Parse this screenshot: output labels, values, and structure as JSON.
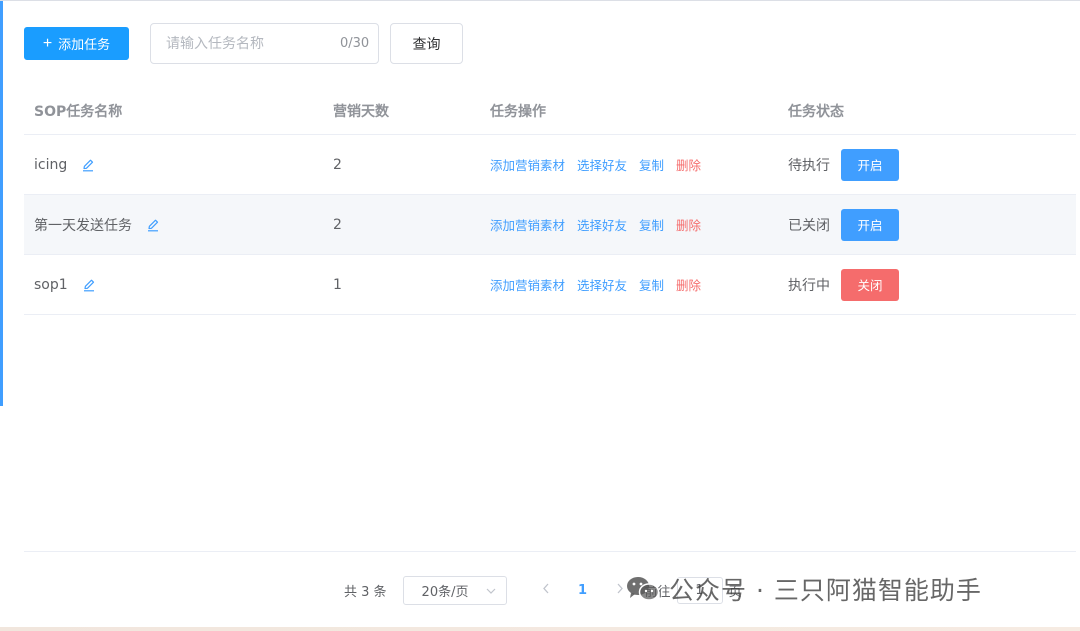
{
  "toolbar": {
    "add_label": "添加任务",
    "search_placeholder": "请输入任务名称",
    "search_value": "",
    "search_count": "0/30",
    "query_label": "查询"
  },
  "table": {
    "headers": [
      "SOP任务名称",
      "营销天数",
      "任务操作",
      "任务状态"
    ],
    "actions": {
      "add_material": "添加营销素材",
      "select_friends": "选择好友",
      "copy": "复制",
      "delete": "删除"
    },
    "rows": [
      {
        "name": "icing",
        "days": "2",
        "status": "待执行",
        "button": "开启",
        "button_color": "#409eff"
      },
      {
        "name": "第一天发送任务",
        "days": "2",
        "status": "已关闭",
        "button": "开启",
        "button_color": "#409eff"
      },
      {
        "name": "sop1",
        "days": "1",
        "status": "执行中",
        "button": "关闭",
        "button_color": "#f56c6c"
      }
    ]
  },
  "pagination": {
    "total": "共 3 条",
    "page_size": "20条/页",
    "current_page": "1",
    "goto_prefix": "前往",
    "goto_value": "1",
    "goto_suffix": "页"
  },
  "watermark": {
    "text": "公众号 · 三只阿猫智能助手"
  },
  "colors": {
    "primary": "#409eff",
    "danger": "#f56c6c",
    "add_button": "#1a9dff"
  },
  "icons": {
    "add": "plus-icon",
    "edit": "pencil-icon",
    "prev": "chevron-left-icon",
    "next": "chevron-right-icon",
    "select": "chevron-down-icon",
    "watermark_logo": "wechat-icon"
  }
}
